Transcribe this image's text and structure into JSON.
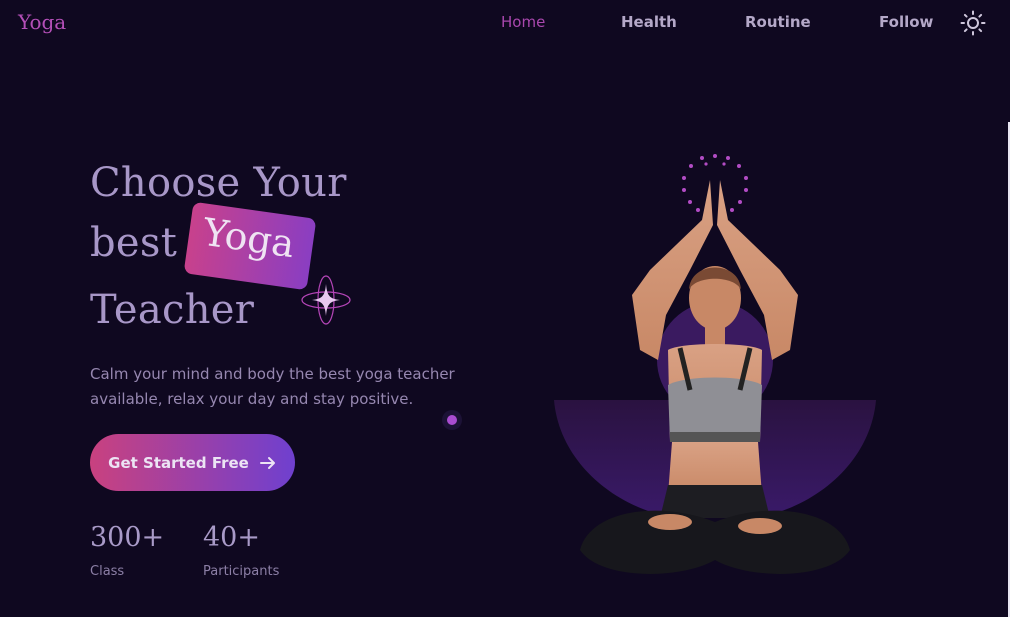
{
  "header": {
    "logo": "Yoga",
    "nav": [
      "Home",
      "Health",
      "Routine",
      "Follow"
    ],
    "active_nav": "Home",
    "theme_toggle_icon": "sun-icon"
  },
  "hero": {
    "title_line1": "Choose Your",
    "title_line2": "best",
    "title_highlight": "Yoga",
    "title_line3": "Teacher",
    "subtitle": "Calm your mind and body the best yoga teacher available, relax your day and stay positive.",
    "cta_label": "Get Started Free",
    "cta_icon": "arrow-right-icon",
    "stats": [
      {
        "value": "300+",
        "label": "Class"
      },
      {
        "value": "40+",
        "label": "Participants"
      }
    ]
  },
  "colors": {
    "background": "#0f0820",
    "accent_pink": "#c8418c",
    "accent_purple": "#6f40cf",
    "nav_active": "#a947ae"
  }
}
